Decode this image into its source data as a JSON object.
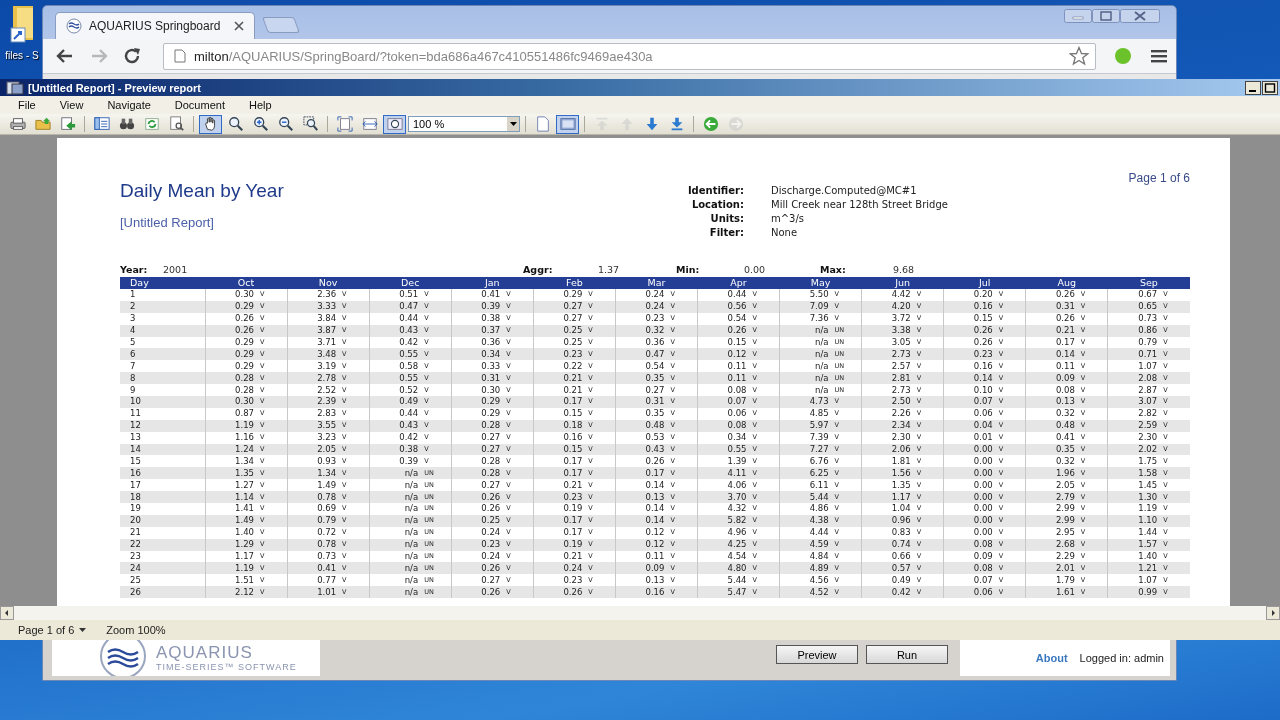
{
  "desktop": {
    "icon_label": "files - S"
  },
  "browser": {
    "tab_title": "AQUARIUS Springboard",
    "url_host": "milton",
    "url_path": "/AQUARIUS/SpringBoard/?token=bda686a467c410551486fc9469ae430a"
  },
  "app_footer": {
    "logo_name": "AQUARIUS",
    "logo_tagline": "TIME-SERIES™ SOFTWARE",
    "buttons": [
      "Preview",
      "Run"
    ],
    "about_link": "About",
    "login_status": "Logged in: admin"
  },
  "preview_window": {
    "title": "[Untitled Report] - Preview report",
    "menu": [
      "File",
      "View",
      "Navigate",
      "Document",
      "Help"
    ],
    "toolbar": [
      {
        "kind": "button",
        "selected": false,
        "disabled": false
      },
      {
        "kind": "button",
        "selected": false,
        "disabled": false
      },
      {
        "kind": "button",
        "selected": false,
        "disabled": false
      },
      {
        "kind": "separator"
      },
      {
        "kind": "button",
        "selected": false,
        "disabled": false
      },
      {
        "kind": "button",
        "selected": false,
        "disabled": false
      },
      {
        "kind": "button",
        "selected": false,
        "disabled": false
      },
      {
        "kind": "button",
        "selected": false,
        "disabled": false
      },
      {
        "kind": "separator"
      },
      {
        "kind": "button",
        "selected": true,
        "disabled": false
      },
      {
        "kind": "button",
        "selected": false,
        "disabled": false
      },
      {
        "kind": "button",
        "selected": false,
        "disabled": false
      },
      {
        "kind": "button",
        "selected": false,
        "disabled": false
      },
      {
        "kind": "button",
        "selected": false,
        "disabled": false
      },
      {
        "kind": "separator"
      },
      {
        "kind": "button",
        "selected": false,
        "disabled": false
      },
      {
        "kind": "button",
        "selected": false,
        "disabled": false
      },
      {
        "kind": "button",
        "selected": true,
        "disabled": false
      },
      {
        "kind": "combo",
        "value": "100 %"
      },
      {
        "kind": "separator"
      },
      {
        "kind": "button",
        "selected": false,
        "disabled": false
      },
      {
        "kind": "button",
        "selected": true,
        "disabled": false
      },
      {
        "kind": "separator"
      },
      {
        "kind": "button",
        "selected": false,
        "disabled": true
      },
      {
        "kind": "button",
        "selected": false,
        "disabled": true
      },
      {
        "kind": "button",
        "selected": false,
        "disabled": false
      },
      {
        "kind": "button",
        "selected": false,
        "disabled": false
      },
      {
        "kind": "separator"
      },
      {
        "kind": "button",
        "selected": false,
        "disabled": false
      },
      {
        "kind": "button",
        "selected": false,
        "disabled": true
      }
    ],
    "report": {
      "title": "Daily Mean by Year",
      "subtitle": "[Untitled Report]",
      "page_number": "Page 1 of 6",
      "meta": [
        {
          "label": "Identifier:",
          "value": "Discharge.Computed@MC#1"
        },
        {
          "label": "Location:",
          "value": "Mill Creek near 128th Street Bridge"
        },
        {
          "label": "Units:",
          "value": "m^3/s"
        },
        {
          "label": "Filter:",
          "value": "None"
        }
      ],
      "summary": [
        {
          "label": "Year:",
          "value": "2001"
        },
        {
          "label": "Aggr:",
          "value": "1.37"
        },
        {
          "label": "Min:",
          "value": "0.00"
        },
        {
          "label": "Max:",
          "value": "9.68"
        }
      ],
      "day_header": "Day",
      "columns": [
        "Oct",
        "Nov",
        "Dec",
        "Jan",
        "Feb",
        "Mar",
        "Apr",
        "May",
        "Jun",
        "Jul",
        "Aug",
        "Sep"
      ],
      "rows": [
        {
          "day": "1",
          "cells": [
            [
              "0.30",
              "V"
            ],
            [
              "2.36",
              "V"
            ],
            [
              "0.51",
              "V"
            ],
            [
              "0.41",
              "V"
            ],
            [
              "0.29",
              "V"
            ],
            [
              "0.24",
              "V"
            ],
            [
              "0.44",
              "V"
            ],
            [
              "5.50",
              "V"
            ],
            [
              "4.42",
              "V"
            ],
            [
              "0.20",
              "V"
            ],
            [
              "0.26",
              "V"
            ],
            [
              "0.67",
              "V"
            ]
          ]
        },
        {
          "day": "2",
          "cells": [
            [
              "0.29",
              "V"
            ],
            [
              "3.33",
              "V"
            ],
            [
              "0.47",
              "V"
            ],
            [
              "0.39",
              "V"
            ],
            [
              "0.27",
              "V"
            ],
            [
              "0.24",
              "V"
            ],
            [
              "0.56",
              "V"
            ],
            [
              "7.09",
              "V"
            ],
            [
              "4.20",
              "V"
            ],
            [
              "0.16",
              "V"
            ],
            [
              "0.31",
              "V"
            ],
            [
              "0.65",
              "V"
            ]
          ]
        },
        {
          "day": "3",
          "cells": [
            [
              "0.26",
              "V"
            ],
            [
              "3.84",
              "V"
            ],
            [
              "0.44",
              "V"
            ],
            [
              "0.38",
              "V"
            ],
            [
              "0.27",
              "V"
            ],
            [
              "0.23",
              "V"
            ],
            [
              "0.54",
              "V"
            ],
            [
              "7.36",
              "V"
            ],
            [
              "3.72",
              "V"
            ],
            [
              "0.15",
              "V"
            ],
            [
              "0.26",
              "V"
            ],
            [
              "0.73",
              "V"
            ]
          ]
        },
        {
          "day": "4",
          "cells": [
            [
              "0.26",
              "V"
            ],
            [
              "3.87",
              "V"
            ],
            [
              "0.43",
              "V"
            ],
            [
              "0.37",
              "V"
            ],
            [
              "0.25",
              "V"
            ],
            [
              "0.32",
              "V"
            ],
            [
              "0.26",
              "V"
            ],
            [
              "n/a",
              "UN"
            ],
            [
              "3.38",
              "V"
            ],
            [
              "0.26",
              "V"
            ],
            [
              "0.21",
              "V"
            ],
            [
              "0.86",
              "V"
            ]
          ]
        },
        {
          "day": "5",
          "cells": [
            [
              "0.29",
              "V"
            ],
            [
              "3.71",
              "V"
            ],
            [
              "0.42",
              "V"
            ],
            [
              "0.36",
              "V"
            ],
            [
              "0.25",
              "V"
            ],
            [
              "0.36",
              "V"
            ],
            [
              "0.15",
              "V"
            ],
            [
              "n/a",
              "UN"
            ],
            [
              "3.05",
              "V"
            ],
            [
              "0.26",
              "V"
            ],
            [
              "0.17",
              "V"
            ],
            [
              "0.79",
              "V"
            ]
          ]
        },
        {
          "day": "6",
          "cells": [
            [
              "0.29",
              "V"
            ],
            [
              "3.48",
              "V"
            ],
            [
              "0.55",
              "V"
            ],
            [
              "0.34",
              "V"
            ],
            [
              "0.23",
              "V"
            ],
            [
              "0.47",
              "V"
            ],
            [
              "0.12",
              "V"
            ],
            [
              "n/a",
              "UN"
            ],
            [
              "2.73",
              "V"
            ],
            [
              "0.23",
              "V"
            ],
            [
              "0.14",
              "V"
            ],
            [
              "0.71",
              "V"
            ]
          ]
        },
        {
          "day": "7",
          "cells": [
            [
              "0.29",
              "V"
            ],
            [
              "3.19",
              "V"
            ],
            [
              "0.58",
              "V"
            ],
            [
              "0.33",
              "V"
            ],
            [
              "0.22",
              "V"
            ],
            [
              "0.54",
              "V"
            ],
            [
              "0.11",
              "V"
            ],
            [
              "n/a",
              "UN"
            ],
            [
              "2.57",
              "V"
            ],
            [
              "0.16",
              "V"
            ],
            [
              "0.11",
              "V"
            ],
            [
              "1.07",
              "V"
            ]
          ]
        },
        {
          "day": "8",
          "cells": [
            [
              "0.28",
              "V"
            ],
            [
              "2.78",
              "V"
            ],
            [
              "0.55",
              "V"
            ],
            [
              "0.31",
              "V"
            ],
            [
              "0.21",
              "V"
            ],
            [
              "0.35",
              "V"
            ],
            [
              "0.11",
              "V"
            ],
            [
              "n/a",
              "UN"
            ],
            [
              "2.81",
              "V"
            ],
            [
              "0.14",
              "V"
            ],
            [
              "0.09",
              "V"
            ],
            [
              "2.08",
              "V"
            ]
          ]
        },
        {
          "day": "9",
          "cells": [
            [
              "0.28",
              "V"
            ],
            [
              "2.52",
              "V"
            ],
            [
              "0.52",
              "V"
            ],
            [
              "0.30",
              "V"
            ],
            [
              "0.21",
              "V"
            ],
            [
              "0.27",
              "V"
            ],
            [
              "0.08",
              "V"
            ],
            [
              "n/a",
              "UN"
            ],
            [
              "2.73",
              "V"
            ],
            [
              "0.10",
              "V"
            ],
            [
              "0.08",
              "V"
            ],
            [
              "2.87",
              "V"
            ]
          ]
        },
        {
          "day": "10",
          "cells": [
            [
              "0.30",
              "V"
            ],
            [
              "2.39",
              "V"
            ],
            [
              "0.49",
              "V"
            ],
            [
              "0.29",
              "V"
            ],
            [
              "0.17",
              "V"
            ],
            [
              "0.31",
              "V"
            ],
            [
              "0.07",
              "V"
            ],
            [
              "4.73",
              "V"
            ],
            [
              "2.50",
              "V"
            ],
            [
              "0.07",
              "V"
            ],
            [
              "0.13",
              "V"
            ],
            [
              "3.07",
              "V"
            ]
          ]
        },
        {
          "day": "11",
          "cells": [
            [
              "0.87",
              "V"
            ],
            [
              "2.83",
              "V"
            ],
            [
              "0.44",
              "V"
            ],
            [
              "0.29",
              "V"
            ],
            [
              "0.15",
              "V"
            ],
            [
              "0.35",
              "V"
            ],
            [
              "0.06",
              "V"
            ],
            [
              "4.85",
              "V"
            ],
            [
              "2.26",
              "V"
            ],
            [
              "0.06",
              "V"
            ],
            [
              "0.32",
              "V"
            ],
            [
              "2.82",
              "V"
            ]
          ]
        },
        {
          "day": "12",
          "cells": [
            [
              "1.19",
              "V"
            ],
            [
              "3.55",
              "V"
            ],
            [
              "0.43",
              "V"
            ],
            [
              "0.28",
              "V"
            ],
            [
              "0.18",
              "V"
            ],
            [
              "0.48",
              "V"
            ],
            [
              "0.08",
              "V"
            ],
            [
              "5.97",
              "V"
            ],
            [
              "2.34",
              "V"
            ],
            [
              "0.04",
              "V"
            ],
            [
              "0.48",
              "V"
            ],
            [
              "2.59",
              "V"
            ]
          ]
        },
        {
          "day": "13",
          "cells": [
            [
              "1.16",
              "V"
            ],
            [
              "3.23",
              "V"
            ],
            [
              "0.42",
              "V"
            ],
            [
              "0.27",
              "V"
            ],
            [
              "0.16",
              "V"
            ],
            [
              "0.53",
              "V"
            ],
            [
              "0.34",
              "V"
            ],
            [
              "7.39",
              "V"
            ],
            [
              "2.30",
              "V"
            ],
            [
              "0.01",
              "V"
            ],
            [
              "0.41",
              "V"
            ],
            [
              "2.30",
              "V"
            ]
          ]
        },
        {
          "day": "14",
          "cells": [
            [
              "1.24",
              "V"
            ],
            [
              "2.05",
              "V"
            ],
            [
              "0.38",
              "V"
            ],
            [
              "0.27",
              "V"
            ],
            [
              "0.15",
              "V"
            ],
            [
              "0.43",
              "V"
            ],
            [
              "0.55",
              "V"
            ],
            [
              "7.27",
              "V"
            ],
            [
              "2.06",
              "V"
            ],
            [
              "0.00",
              "V"
            ],
            [
              "0.35",
              "V"
            ],
            [
              "2.02",
              "V"
            ]
          ]
        },
        {
          "day": "15",
          "cells": [
            [
              "1.34",
              "V"
            ],
            [
              "0.93",
              "V"
            ],
            [
              "0.39",
              "V"
            ],
            [
              "0.28",
              "V"
            ],
            [
              "0.17",
              "V"
            ],
            [
              "0.26",
              "V"
            ],
            [
              "1.39",
              "V"
            ],
            [
              "6.76",
              "V"
            ],
            [
              "1.81",
              "V"
            ],
            [
              "0.00",
              "V"
            ],
            [
              "0.32",
              "V"
            ],
            [
              "1.75",
              "V"
            ]
          ]
        },
        {
          "day": "16",
          "cells": [
            [
              "1.35",
              "V"
            ],
            [
              "1.34",
              "V"
            ],
            [
              "n/a",
              "UN"
            ],
            [
              "0.28",
              "V"
            ],
            [
              "0.17",
              "V"
            ],
            [
              "0.17",
              "V"
            ],
            [
              "4.11",
              "V"
            ],
            [
              "6.25",
              "V"
            ],
            [
              "1.56",
              "V"
            ],
            [
              "0.00",
              "V"
            ],
            [
              "1.96",
              "V"
            ],
            [
              "1.58",
              "V"
            ]
          ]
        },
        {
          "day": "17",
          "cells": [
            [
              "1.27",
              "V"
            ],
            [
              "1.49",
              "V"
            ],
            [
              "n/a",
              "UN"
            ],
            [
              "0.27",
              "V"
            ],
            [
              "0.21",
              "V"
            ],
            [
              "0.14",
              "V"
            ],
            [
              "4.06",
              "V"
            ],
            [
              "6.11",
              "V"
            ],
            [
              "1.35",
              "V"
            ],
            [
              "0.00",
              "V"
            ],
            [
              "2.05",
              "V"
            ],
            [
              "1.45",
              "V"
            ]
          ]
        },
        {
          "day": "18",
          "cells": [
            [
              "1.14",
              "V"
            ],
            [
              "0.78",
              "V"
            ],
            [
              "n/a",
              "UN"
            ],
            [
              "0.26",
              "V"
            ],
            [
              "0.23",
              "V"
            ],
            [
              "0.13",
              "V"
            ],
            [
              "3.70",
              "V"
            ],
            [
              "5.44",
              "V"
            ],
            [
              "1.17",
              "V"
            ],
            [
              "0.00",
              "V"
            ],
            [
              "2.79",
              "V"
            ],
            [
              "1.30",
              "V"
            ]
          ]
        },
        {
          "day": "19",
          "cells": [
            [
              "1.41",
              "V"
            ],
            [
              "0.69",
              "V"
            ],
            [
              "n/a",
              "UN"
            ],
            [
              "0.26",
              "V"
            ],
            [
              "0.19",
              "V"
            ],
            [
              "0.14",
              "V"
            ],
            [
              "4.32",
              "V"
            ],
            [
              "4.86",
              "V"
            ],
            [
              "1.04",
              "V"
            ],
            [
              "0.00",
              "V"
            ],
            [
              "2.99",
              "V"
            ],
            [
              "1.19",
              "V"
            ]
          ]
        },
        {
          "day": "20",
          "cells": [
            [
              "1.49",
              "V"
            ],
            [
              "0.79",
              "V"
            ],
            [
              "n/a",
              "UN"
            ],
            [
              "0.25",
              "V"
            ],
            [
              "0.17",
              "V"
            ],
            [
              "0.14",
              "V"
            ],
            [
              "5.82",
              "V"
            ],
            [
              "4.38",
              "V"
            ],
            [
              "0.96",
              "V"
            ],
            [
              "0.00",
              "V"
            ],
            [
              "2.99",
              "V"
            ],
            [
              "1.10",
              "V"
            ]
          ]
        },
        {
          "day": "21",
          "cells": [
            [
              "1.40",
              "V"
            ],
            [
              "0.72",
              "V"
            ],
            [
              "n/a",
              "UN"
            ],
            [
              "0.24",
              "V"
            ],
            [
              "0.17",
              "V"
            ],
            [
              "0.12",
              "V"
            ],
            [
              "4.96",
              "V"
            ],
            [
              "4.44",
              "V"
            ],
            [
              "0.83",
              "V"
            ],
            [
              "0.00",
              "V"
            ],
            [
              "2.95",
              "V"
            ],
            [
              "1.44",
              "V"
            ]
          ]
        },
        {
          "day": "22",
          "cells": [
            [
              "1.29",
              "V"
            ],
            [
              "0.78",
              "V"
            ],
            [
              "n/a",
              "UN"
            ],
            [
              "0.23",
              "V"
            ],
            [
              "0.19",
              "V"
            ],
            [
              "0.12",
              "V"
            ],
            [
              "4.25",
              "V"
            ],
            [
              "4.59",
              "V"
            ],
            [
              "0.74",
              "V"
            ],
            [
              "0.08",
              "V"
            ],
            [
              "2.68",
              "V"
            ],
            [
              "1.57",
              "V"
            ]
          ]
        },
        {
          "day": "23",
          "cells": [
            [
              "1.17",
              "V"
            ],
            [
              "0.73",
              "V"
            ],
            [
              "n/a",
              "UN"
            ],
            [
              "0.24",
              "V"
            ],
            [
              "0.21",
              "V"
            ],
            [
              "0.11",
              "V"
            ],
            [
              "4.54",
              "V"
            ],
            [
              "4.84",
              "V"
            ],
            [
              "0.66",
              "V"
            ],
            [
              "0.09",
              "V"
            ],
            [
              "2.29",
              "V"
            ],
            [
              "1.40",
              "V"
            ]
          ]
        },
        {
          "day": "24",
          "cells": [
            [
              "1.19",
              "V"
            ],
            [
              "0.41",
              "V"
            ],
            [
              "n/a",
              "UN"
            ],
            [
              "0.26",
              "V"
            ],
            [
              "0.24",
              "V"
            ],
            [
              "0.09",
              "V"
            ],
            [
              "4.80",
              "V"
            ],
            [
              "4.89",
              "V"
            ],
            [
              "0.57",
              "V"
            ],
            [
              "0.08",
              "V"
            ],
            [
              "2.01",
              "V"
            ],
            [
              "1.21",
              "V"
            ]
          ]
        },
        {
          "day": "25",
          "cells": [
            [
              "1.51",
              "V"
            ],
            [
              "0.77",
              "V"
            ],
            [
              "n/a",
              "UN"
            ],
            [
              "0.27",
              "V"
            ],
            [
              "0.23",
              "V"
            ],
            [
              "0.13",
              "V"
            ],
            [
              "5.44",
              "V"
            ],
            [
              "4.56",
              "V"
            ],
            [
              "0.49",
              "V"
            ],
            [
              "0.07",
              "V"
            ],
            [
              "1.79",
              "V"
            ],
            [
              "1.07",
              "V"
            ]
          ]
        },
        {
          "day": "26",
          "cells": [
            [
              "2.12",
              "V"
            ],
            [
              "1.01",
              "V"
            ],
            [
              "n/a",
              "UN"
            ],
            [
              "0.26",
              "V"
            ],
            [
              "0.26",
              "V"
            ],
            [
              "0.16",
              "V"
            ],
            [
              "5.47",
              "V"
            ],
            [
              "4.52",
              "V"
            ],
            [
              "0.42",
              "V"
            ],
            [
              "0.06",
              "V"
            ],
            [
              "1.61",
              "V"
            ],
            [
              "0.99",
              "V"
            ]
          ]
        }
      ]
    },
    "status_bar": {
      "page": "Page 1 of 6",
      "zoom": "Zoom 100%"
    }
  }
}
